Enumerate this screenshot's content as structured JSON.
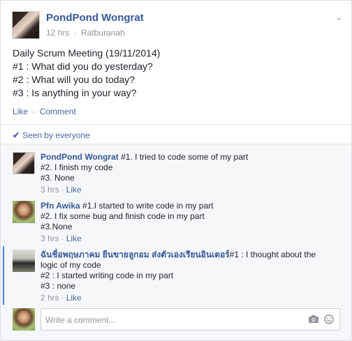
{
  "post": {
    "author": "PondPond Wongrat",
    "time": "12 hrs",
    "location": "Ratburanah",
    "separator": "·",
    "body_lines": [
      "Daily Scrum Meeting (19/11/2014)",
      "#1 : What did you do yesterday?",
      "#2 : What will you do today?",
      "#3 : Is anything in your way?"
    ],
    "like_label": "Like",
    "comment_label": "Comment",
    "chevron": "⌄"
  },
  "seen": {
    "label": "Seen by everyone",
    "check": "✔"
  },
  "comments": [
    {
      "author": "PondPond Wongrat",
      "first_line": "#1. I tried to code some of my part",
      "more_lines": [
        "#2. I finish my code",
        "#3. None"
      ],
      "time": "3 hrs",
      "like": "Like"
    },
    {
      "author": "Pfn Awika",
      "first_line": "#1.I started to write code in my part",
      "more_lines": [
        "#2. I fix some bug and finish code in my part",
        "#3.None"
      ],
      "time": "3 hrs",
      "like": "Like"
    },
    {
      "author": "ฉันชื่อพฤษภาคม ยืนขายลูกอม ส่งตัวเองเรียนอินเตอร์",
      "first_line": "#1 : I thought about the",
      "wrap_line": "logic of my code",
      "more_lines": [
        "#2 : I started writing code in my part",
        "#3 : none"
      ],
      "time": "2 hrs",
      "like": "Like"
    }
  ],
  "composer": {
    "placeholder": "Write a comment...",
    "camera_icon": "camera-icon",
    "smile_icon": "smile-icon"
  },
  "colors": {
    "link": "#365899",
    "accent": "#4080ff",
    "meta": "#90949c"
  }
}
